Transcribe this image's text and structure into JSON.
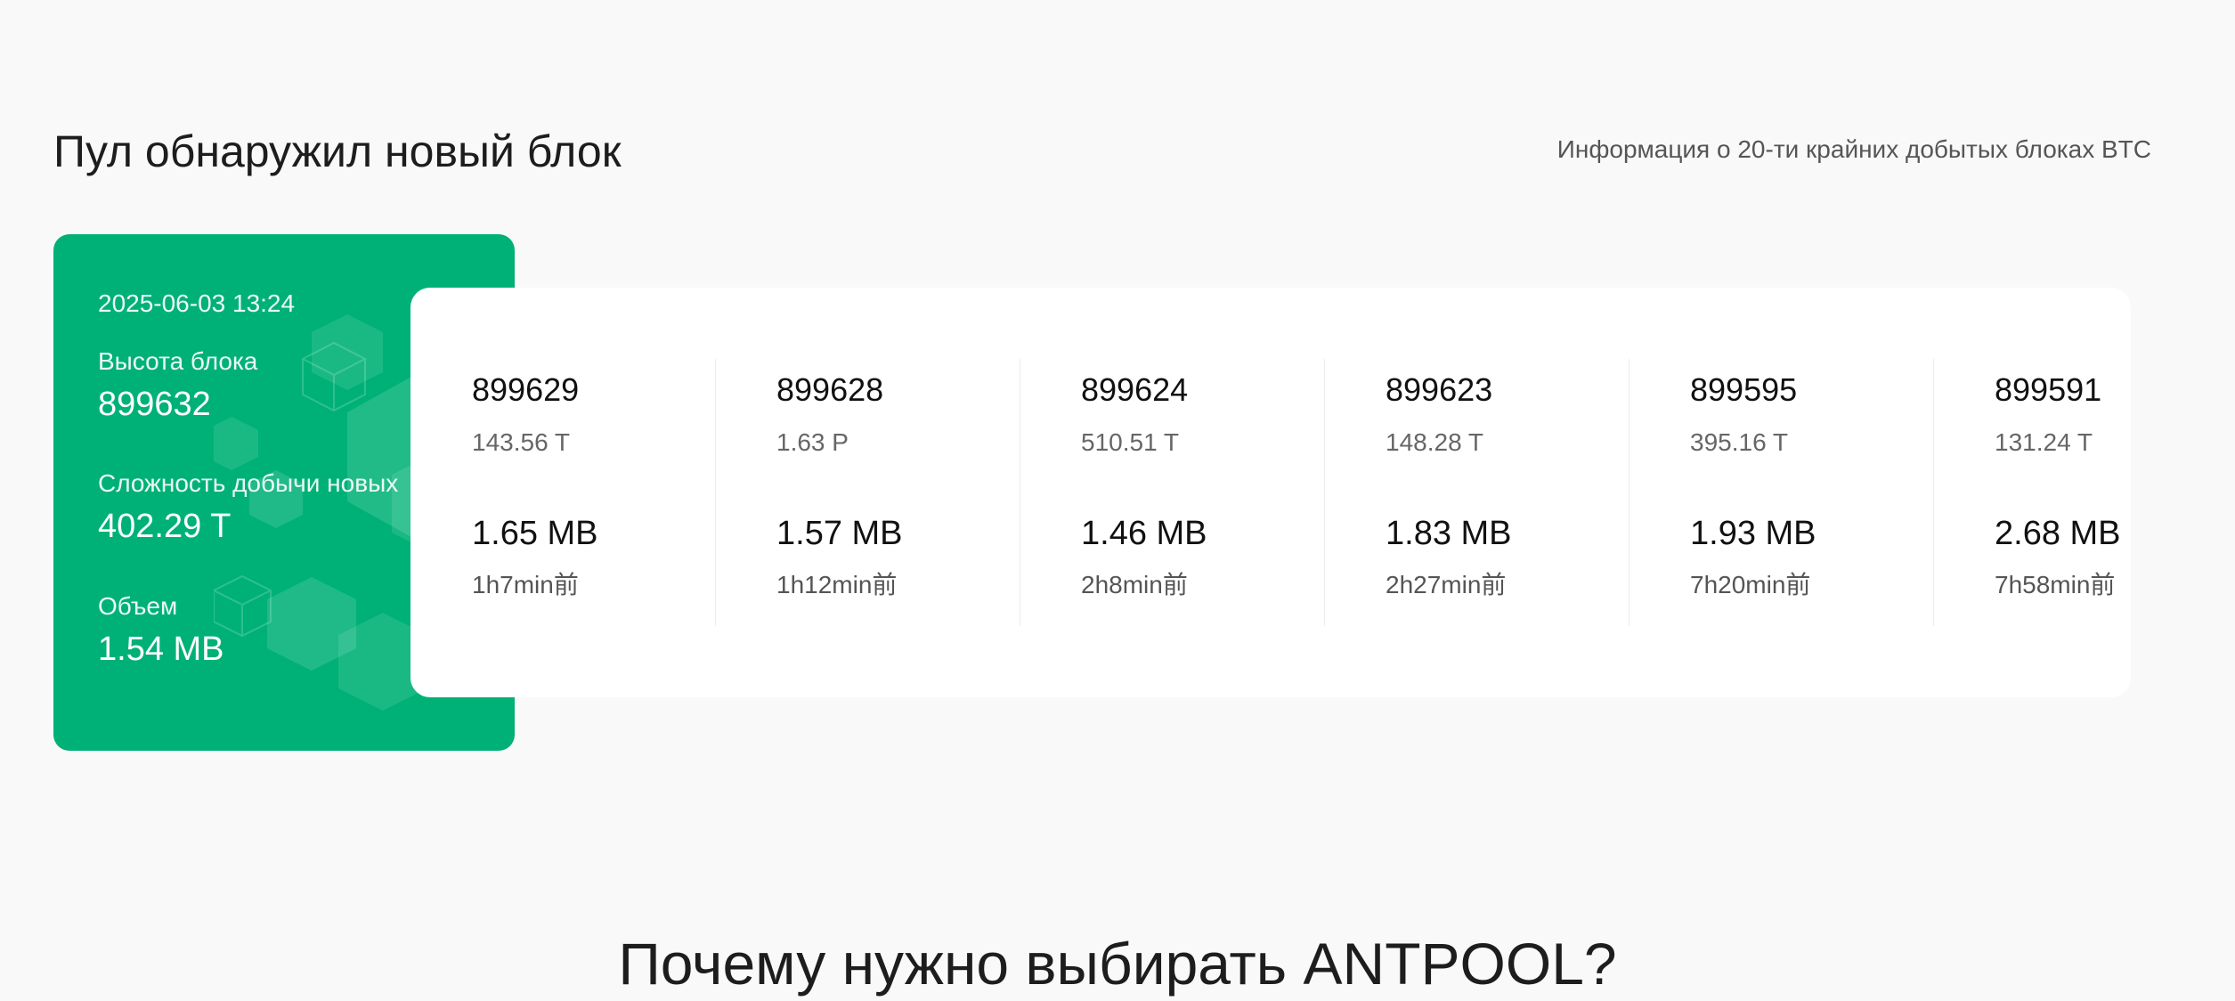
{
  "header": {
    "title": "Пул обнаружил новый блок",
    "subtitle": "Информация о 20-ти крайних добытых блоках BTC"
  },
  "latest_block": {
    "time": "2025-06-03 13:24",
    "height_label": "Высота блока",
    "height": "899632",
    "difficulty_label": "Сложность добычи новых",
    "difficulty": "402.29 T",
    "size_label": "Объем",
    "size": "1.54 MB"
  },
  "blocks": [
    {
      "height": "899629",
      "difficulty": "143.56 T",
      "size": "1.65 MB",
      "ago": "1h7min前"
    },
    {
      "height": "899628",
      "difficulty": "1.63 P",
      "size": "1.57 MB",
      "ago": "1h12min前"
    },
    {
      "height": "899624",
      "difficulty": "510.51 T",
      "size": "1.46 MB",
      "ago": "2h8min前"
    },
    {
      "height": "899623",
      "difficulty": "148.28 T",
      "size": "1.83 MB",
      "ago": "2h27min前"
    },
    {
      "height": "899595",
      "difficulty": "395.16 T",
      "size": "1.93 MB",
      "ago": "7h20min前"
    },
    {
      "height": "899591",
      "difficulty": "131.24 T",
      "size": "2.68 MB",
      "ago": "7h58min前"
    }
  ],
  "why_section": {
    "title": "Почему нужно выбирать ANTPOOL?"
  },
  "colors": {
    "accent": "#00b177",
    "background": "#f9f9f9",
    "panel": "#ffffff"
  }
}
